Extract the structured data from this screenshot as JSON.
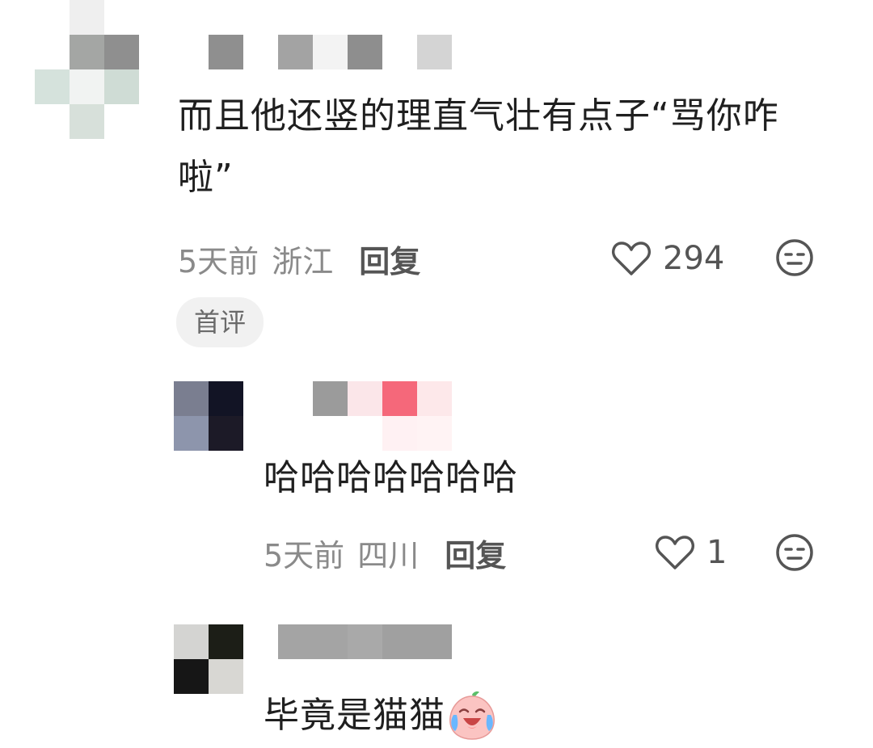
{
  "comments": [
    {
      "text": "而且他还竖的理直气壮有点子“骂你咋啦”",
      "time": "5天前",
      "location": "浙江",
      "reply_label": "回复",
      "likes": "294",
      "badge": "首评"
    },
    {
      "text": "哈哈哈哈哈哈哈",
      "time": "5天前",
      "location": "四川",
      "reply_label": "回复",
      "likes": "1"
    },
    {
      "text": "毕竟是猫猫",
      "emoji": "cry-laugh-peach-emoji"
    }
  ],
  "icons": {
    "like": "heart-outline-icon",
    "dislike": "meh-face-icon"
  },
  "colors": {
    "text": "#1f1f1f",
    "meta": "#8a8a8a",
    "badge_bg": "#f1f1f1"
  }
}
